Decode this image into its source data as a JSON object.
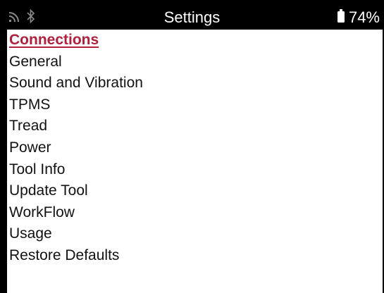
{
  "status_bar": {
    "title": "Settings",
    "battery_level": "74%",
    "icons": [
      "wifi-icon",
      "bluetooth-icon",
      "battery-icon"
    ]
  },
  "colors": {
    "selected_item": "#b0203c",
    "background": "#ffffff",
    "status_bar": "#000000"
  },
  "menu": {
    "selected_index": 0,
    "items": [
      {
        "label": "Connections"
      },
      {
        "label": "General"
      },
      {
        "label": "Sound and Vibration"
      },
      {
        "label": "TPMS"
      },
      {
        "label": "Tread"
      },
      {
        "label": "Power"
      },
      {
        "label": "Tool Info"
      },
      {
        "label": "Update Tool"
      },
      {
        "label": "WorkFlow"
      },
      {
        "label": "Usage"
      },
      {
        "label": "Restore Defaults"
      }
    ]
  }
}
